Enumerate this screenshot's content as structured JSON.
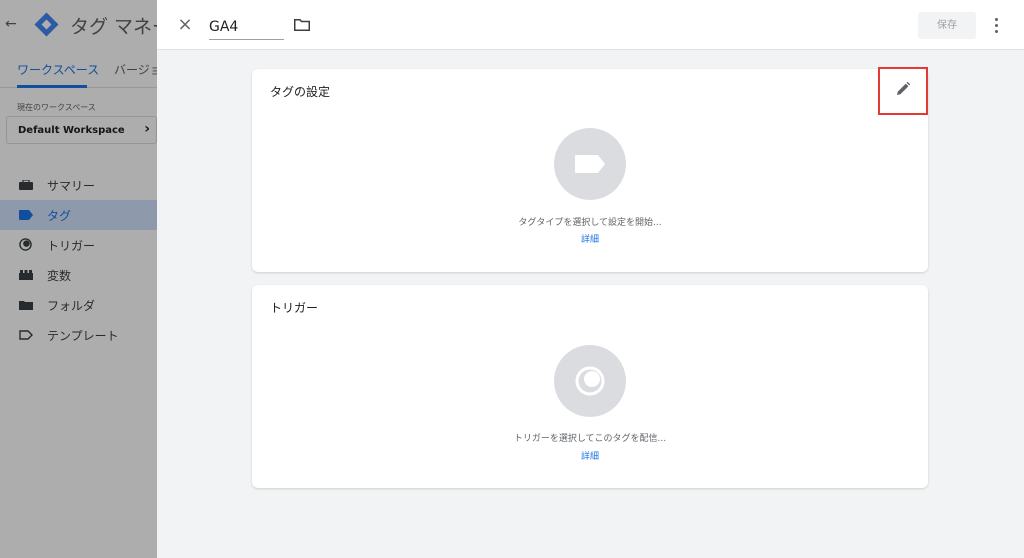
{
  "app": {
    "back_symbol": "←",
    "title": "タグ マネー",
    "tabs": {
      "workspace": "ワークスペース",
      "versions": "バージョ"
    },
    "current_workspace_label": "現在のワークスペース",
    "workspace_name": "Default Workspace",
    "workspace_chevron": "›",
    "nav": [
      {
        "label": "サマリー",
        "icon": "briefcase-icon"
      },
      {
        "label": "タグ",
        "icon": "tag-icon",
        "active": true
      },
      {
        "label": "トリガー",
        "icon": "trigger-icon"
      },
      {
        "label": "変数",
        "icon": "variables-icon"
      },
      {
        "label": "フォルダ",
        "icon": "folder-icon"
      },
      {
        "label": "テンプレート",
        "icon": "template-icon"
      }
    ]
  },
  "panel": {
    "close_symbol": "×",
    "tag_name": "GA4",
    "save_label": "保存",
    "tag_config": {
      "title": "タグの設定",
      "hint": "タグタイプを選択して設定を開始...",
      "link": "詳細"
    },
    "trigger": {
      "title": "トリガー",
      "hint": "トリガーを選択してこのタグを配信...",
      "link": "詳細"
    }
  },
  "colors": {
    "accent": "#1a73e8",
    "highlight": "#e53935",
    "active_nav_bg": "#d2e3fc",
    "panel_bg": "#f1f3f4",
    "placeholder_circle": "#dadce0"
  }
}
